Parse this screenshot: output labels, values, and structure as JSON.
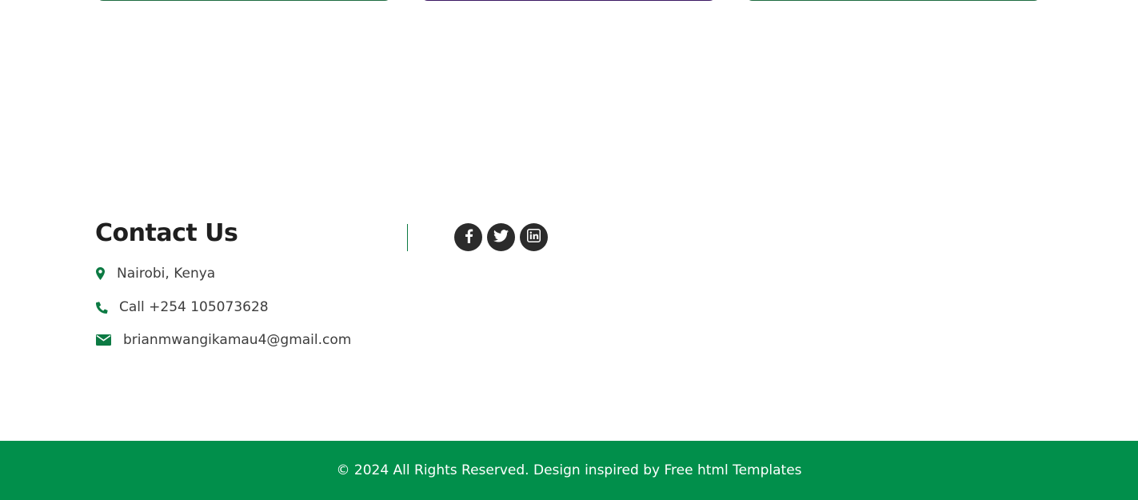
{
  "colors": {
    "accent": "#018f4b",
    "icon": "#0c7a43",
    "social_bg": "#2b2b2b",
    "card_green": "#1e6b40",
    "card_purple": "#3b1763"
  },
  "contact": {
    "title": "Contact Us",
    "location": {
      "icon": "map-marker-icon",
      "text": "Nairobi, Kenya"
    },
    "phone": {
      "icon": "phone-icon",
      "text": "Call +254 105073628"
    },
    "email": {
      "icon": "envelope-icon",
      "text": "brianmwangikamau4@gmail.com"
    }
  },
  "socials": [
    {
      "icon": "facebook-icon"
    },
    {
      "icon": "twitter-icon"
    },
    {
      "icon": "linkedin-icon"
    }
  ],
  "footer": {
    "text": "© 2024 All Rights Reserved. Design inspired by",
    "link": "Free html Templates"
  }
}
